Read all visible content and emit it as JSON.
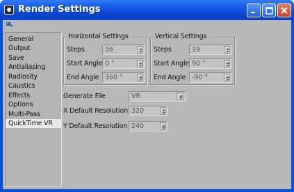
{
  "window": {
    "title": "Render Settings",
    "accent_color": "#0a4fd6",
    "close_color": "#d8512f"
  },
  "sidebar": {
    "items": [
      {
        "label": "General"
      },
      {
        "label": "Output"
      },
      {
        "label": "Save"
      },
      {
        "label": "Antialiasing"
      },
      {
        "label": "Radiosity"
      },
      {
        "label": "Caustics"
      },
      {
        "label": "Effects"
      },
      {
        "label": "Options"
      },
      {
        "label": "Multi-Pass"
      },
      {
        "label": "QuickTime VR",
        "selected": true
      }
    ]
  },
  "horizontal": {
    "title": "Horizontal Settings",
    "steps_label": "Steps",
    "steps_value": "36",
    "start_label": "Start Angle",
    "start_value": "0 °",
    "end_label": "End Angle",
    "end_value": "360 °"
  },
  "vertical": {
    "title": "Vertical Settings",
    "steps_label": "Steps",
    "steps_value": "19",
    "start_label": "Start Angle",
    "start_value": "90 °",
    "end_label": "End Angle",
    "end_value": "-90 °"
  },
  "generate_file": {
    "label": "Generate File",
    "value": "VR"
  },
  "x_resolution": {
    "label": "X Default Resolution",
    "value": "320"
  },
  "y_resolution": {
    "label": "Y Default Resolution",
    "value": "240"
  }
}
